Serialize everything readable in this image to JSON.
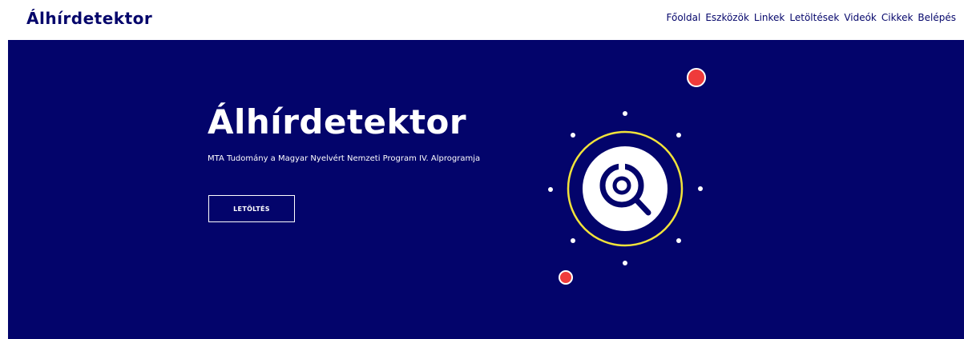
{
  "header": {
    "brand": "Álhírdetektor",
    "nav": [
      "Főoldal",
      "Eszközök",
      "Linkek",
      "Letöltések",
      "Videók",
      "Cikkek",
      "Belépés"
    ]
  },
  "hero": {
    "title": "Álhírdetektor",
    "subtitle": "MTA Tudomány a Magyar Nyelvért Nemzeti Program IV. Alprogramja",
    "button_label": "LETÖLTÉS"
  },
  "colors": {
    "brand_navy": "#03046b",
    "accent_red": "#ef3b3b",
    "ring_yellow": "#f2e33a"
  },
  "icons": {
    "logo_icon": "magnifier-target-icon"
  }
}
